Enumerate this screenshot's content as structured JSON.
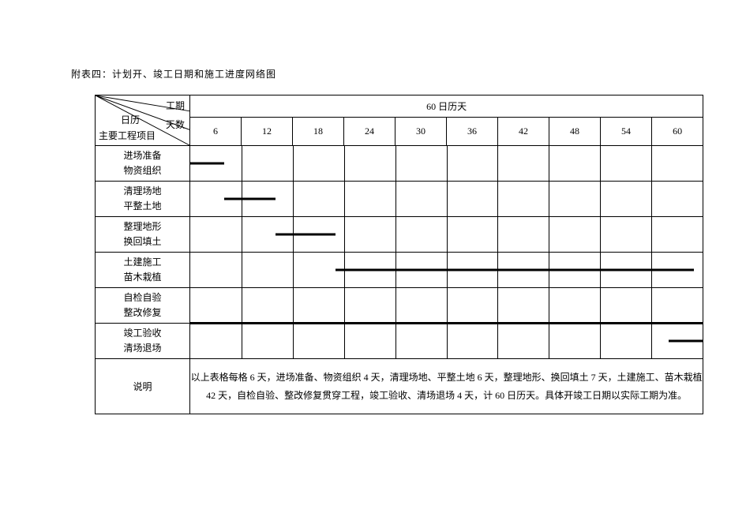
{
  "title": "附表四：计划开、竣工日期和施工进度网络图",
  "header": {
    "corner": {
      "top_right": "工期",
      "mid_left": "日历",
      "mid_right": "天数",
      "bottom_left": "主要工程项目"
    },
    "span_label": "60 日历天",
    "days": [
      "6",
      "12",
      "18",
      "24",
      "30",
      "36",
      "42",
      "48",
      "54",
      "60"
    ]
  },
  "tasks": [
    {
      "label_a": "进场准备",
      "label_b": "物资组织"
    },
    {
      "label_a": "清理场地",
      "label_b": "平整土地"
    },
    {
      "label_a": "整理地形",
      "label_b": "换回填土"
    },
    {
      "label_a": "土建施工",
      "label_b": "苗木栽植"
    },
    {
      "label_a": "自检自验",
      "label_b": "整改修复"
    },
    {
      "label_a": "竣工验收",
      "label_b": "清场退场"
    }
  ],
  "desc_label": "说明",
  "desc_text": "以上表格每格 6 天，进场准备、物资组织 4 天，清理场地、平整土地 6 天，整理地形、换回填土 7 天，土建施工、苗木栽植 42 天，自检自验、整改修复贯穿工程，竣工验收、清场退场 4 天，计 60 日历天。具体开竣工日期以实际工期为准。",
  "chart_data": {
    "type": "bar",
    "title": "计划开、竣工日期和施工进度网络图",
    "xlabel": "日历天数",
    "ylabel": "主要工程项目",
    "xlim": [
      0,
      60
    ],
    "x_tick_interval": 6,
    "categories": [
      "进场准备 物资组织",
      "清理场地 平整土地",
      "整理地形 换回填土",
      "土建施工 苗木栽植",
      "自检自验 整改修复",
      "竣工验收 清场退场"
    ],
    "series": [
      {
        "name": "start_day",
        "values": [
          0,
          4,
          10,
          17,
          0,
          56
        ]
      },
      {
        "name": "duration_days",
        "values": [
          4,
          6,
          7,
          42,
          60,
          4
        ]
      },
      {
        "name": "end_day",
        "values": [
          4,
          10,
          17,
          59,
          60,
          60
        ]
      }
    ],
    "total_days": 60
  }
}
